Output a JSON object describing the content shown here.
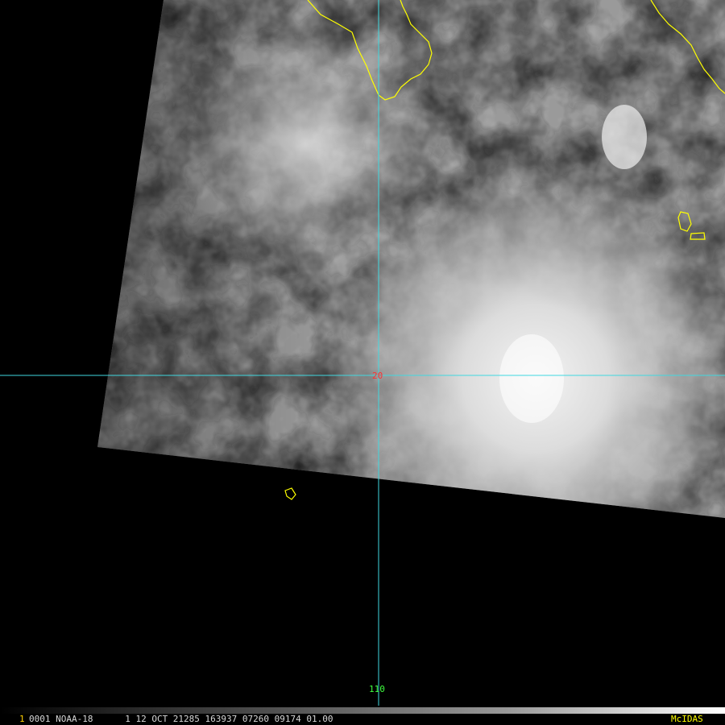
{
  "map": {
    "lat_grid_label": "20",
    "lon_grid_label": "110",
    "colors": {
      "background": "#000000",
      "gridline": "#40d8e0",
      "coastline": "#ffff00",
      "lat_label": "#ff3030",
      "lon_label": "#40ff40"
    }
  },
  "status_bar": {
    "frame_index": "1",
    "info": "0001 NOAA-18      1 12 OCT 21285 163937 07260 09174 01.00",
    "brand": "McIDAS"
  }
}
